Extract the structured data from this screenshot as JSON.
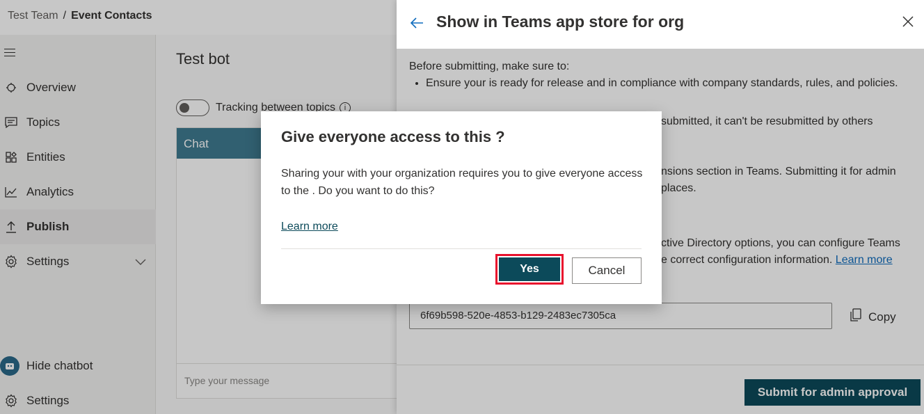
{
  "breadcrumb": {
    "team": "Test Team",
    "separator": "/",
    "current": "Event Contacts"
  },
  "nav": {
    "items": [
      {
        "label": "Overview",
        "icon": "overview-icon"
      },
      {
        "label": "Topics",
        "icon": "topics-icon"
      },
      {
        "label": "Entities",
        "icon": "entities-icon"
      },
      {
        "label": "Analytics",
        "icon": "analytics-icon"
      },
      {
        "label": "Publish",
        "icon": "publish-icon",
        "active": true
      },
      {
        "label": "Settings",
        "icon": "settings-icon"
      }
    ],
    "bottom": [
      {
        "label": "Hide chatbot",
        "icon": "bot-avatar-icon"
      },
      {
        "label": "Settings",
        "icon": "settings-icon"
      }
    ]
  },
  "main": {
    "title": "Test bot",
    "toggle_label": "Tracking between topics",
    "info_glyph": "i",
    "chat_header": "Chat",
    "chat_placeholder": "Type your message"
  },
  "panel": {
    "title": "Show in Teams app store for org",
    "intro": "Before submitting, make sure to:",
    "bullet1": "Ensure your is ready for release and in compliance with company standards, rules, and policies.",
    "line_a": "submitted, it can't be resubmitted by others",
    "line_b": "nsions section in Teams. Submitting it for admin",
    "line_c": "places.",
    "line_d": "ctive Directory options, you can configure Teams",
    "line_e": "e correct configuration information.",
    "learn_more": "Learn more",
    "app_id": "6f69b598-520e-4853-b129-2483ec7305ca",
    "copy_label": "Copy",
    "submit_label": "Submit for admin approval"
  },
  "dialog": {
    "title": "Give everyone access to this ?",
    "text": "Sharing your with your organization requires you to give everyone access to the . Do you want to do this?",
    "learn_more": "Learn more",
    "yes_label": "Yes",
    "cancel_label": "Cancel"
  },
  "colors": {
    "accent": "#0c4a5a",
    "highlight": "#e8112d",
    "chat_header": "#3f7b91"
  }
}
